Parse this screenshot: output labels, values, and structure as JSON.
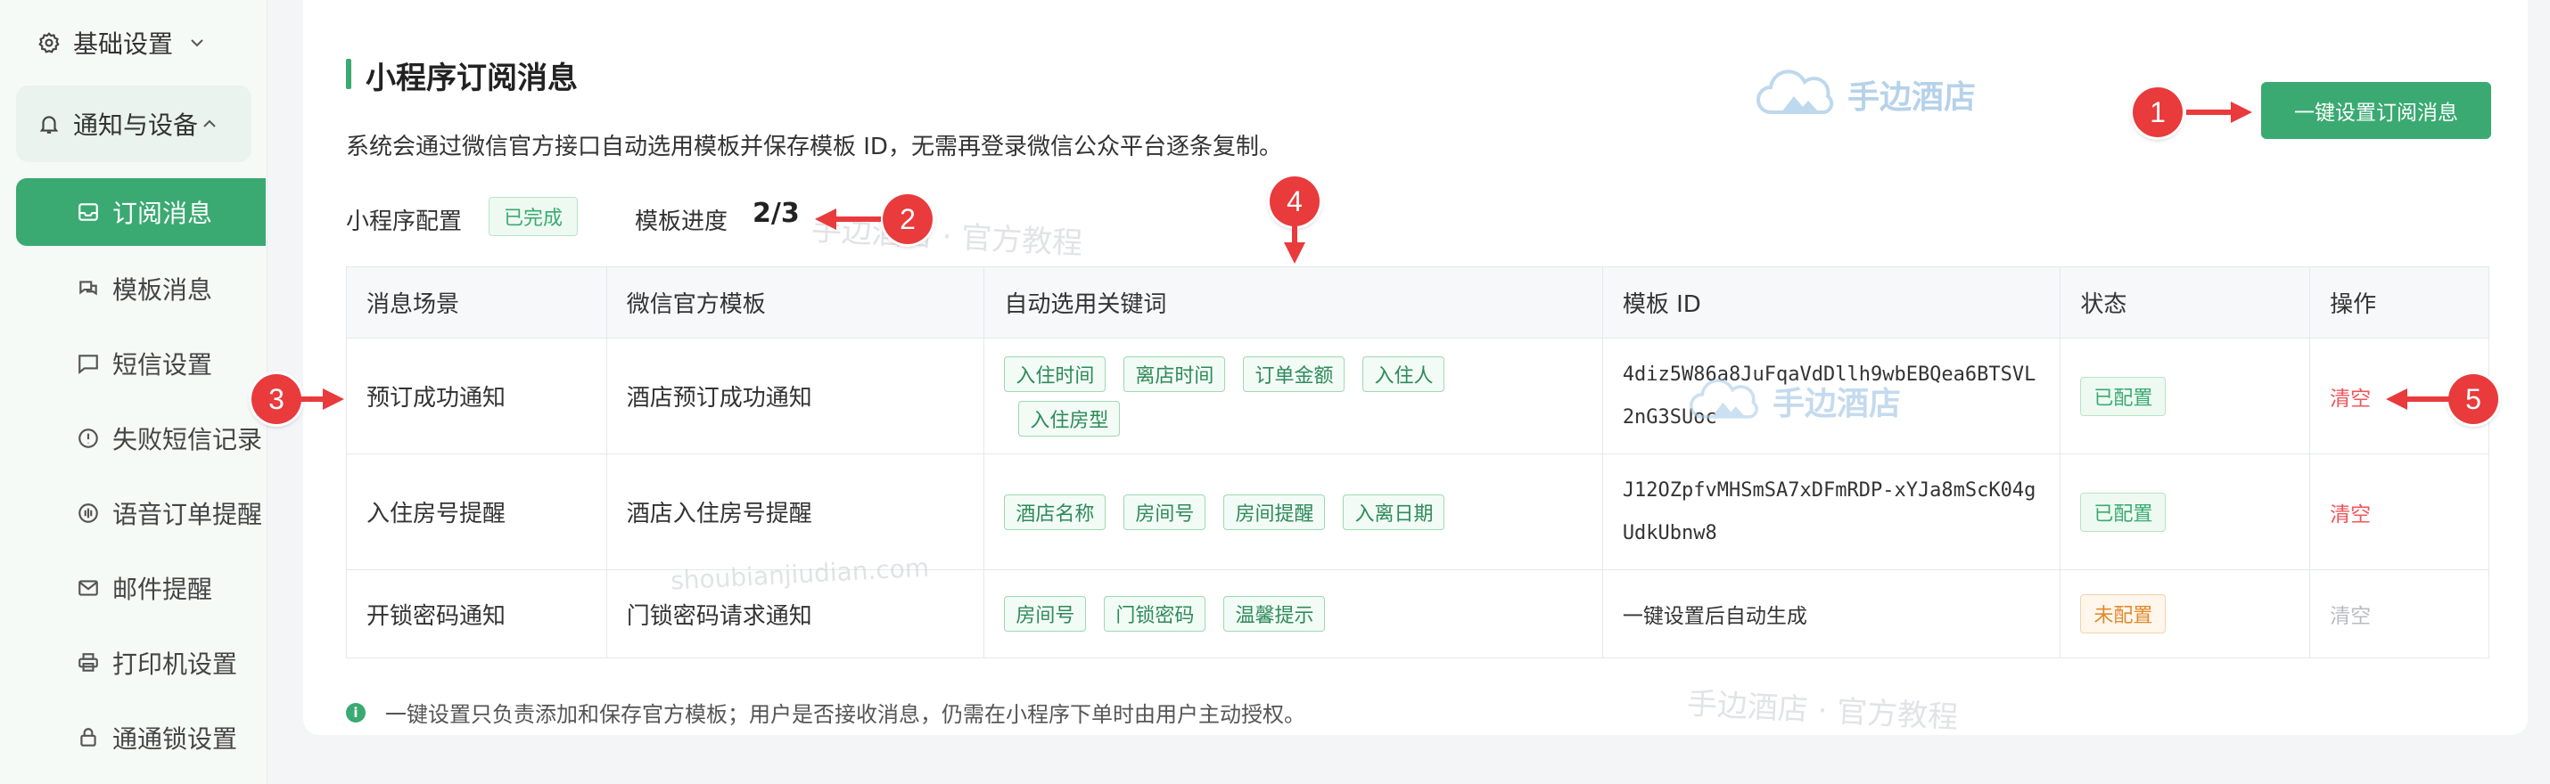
{
  "sidebar": {
    "groups": [
      {
        "label": "基础设置",
        "icon": "gear-icon"
      },
      {
        "label": "通知与设备",
        "icon": "bell-icon"
      }
    ],
    "items": [
      {
        "label": "订阅消息",
        "icon": "inbox-icon",
        "active": true
      },
      {
        "label": "模板消息",
        "icon": "chat-bubbles-icon"
      },
      {
        "label": "短信设置",
        "icon": "message-square-icon"
      },
      {
        "label": "失败短信记录",
        "icon": "alert-circle-icon"
      },
      {
        "label": "语音订单提醒",
        "icon": "voice-icon"
      },
      {
        "label": "邮件提醒",
        "icon": "mail-icon"
      },
      {
        "label": "打印机设置",
        "icon": "printer-icon"
      },
      {
        "label": "通通锁设置",
        "icon": "lock-icon"
      }
    ]
  },
  "main": {
    "title": "小程序订阅消息",
    "description": "系统会通过微信官方接口自动选用模板并保存模板 ID，无需再登录微信公众平台逐条复制。",
    "primary_button": "一键设置订阅消息",
    "config_label": "小程序配置",
    "config_status": "已完成",
    "progress_label": "模板进度",
    "progress_value": "2/3",
    "table": {
      "headers": [
        "消息场景",
        "微信官方模板",
        "自动选用关键词",
        "模板 ID",
        "状态",
        "操作"
      ],
      "rows": [
        {
          "scene": "预订成功通知",
          "template": "酒店预订成功通知",
          "keywords": [
            "入住时间",
            "离店时间",
            "订单金额",
            "入住人",
            "入住房型"
          ],
          "template_id": "4diz5W86a8JuFqaVdDllh9wbEBQea6BTSVL2nG3SUoc",
          "status": "已配置",
          "status_type": "ok",
          "action": "清空",
          "action_enabled": true
        },
        {
          "scene": "入住房号提醒",
          "template": "酒店入住房号提醒",
          "keywords": [
            "酒店名称",
            "房间号",
            "房间提醒",
            "入离日期"
          ],
          "template_id": "J12OZpfvMHSmSA7xDFmRDP-xYJa8mScK04gUdkUbnw8",
          "status": "已配置",
          "status_type": "ok",
          "action": "清空",
          "action_enabled": true
        },
        {
          "scene": "开锁密码通知",
          "template": "门锁密码请求通知",
          "keywords": [
            "房间号",
            "门锁密码",
            "温馨提示"
          ],
          "template_id": "一键设置后自动生成",
          "status": "未配置",
          "status_type": "pending",
          "action": "清空",
          "action_enabled": false
        }
      ]
    },
    "footnote": "一键设置只负责添加和保存官方模板；用户是否接收消息，仍需在小程序下单时由用户主动授权。"
  },
  "annotations": [
    "1",
    "2",
    "3",
    "4",
    "5"
  ],
  "watermarks": {
    "brand": "手边酒店",
    "tutorial": "手边酒店 · 官方教程",
    "url": "shoubianjiudian.com"
  },
  "colors": {
    "accent": "#3aaa72",
    "danger": "#f0555a",
    "warning": "#e08a2e",
    "marker": "#e93a3c"
  }
}
